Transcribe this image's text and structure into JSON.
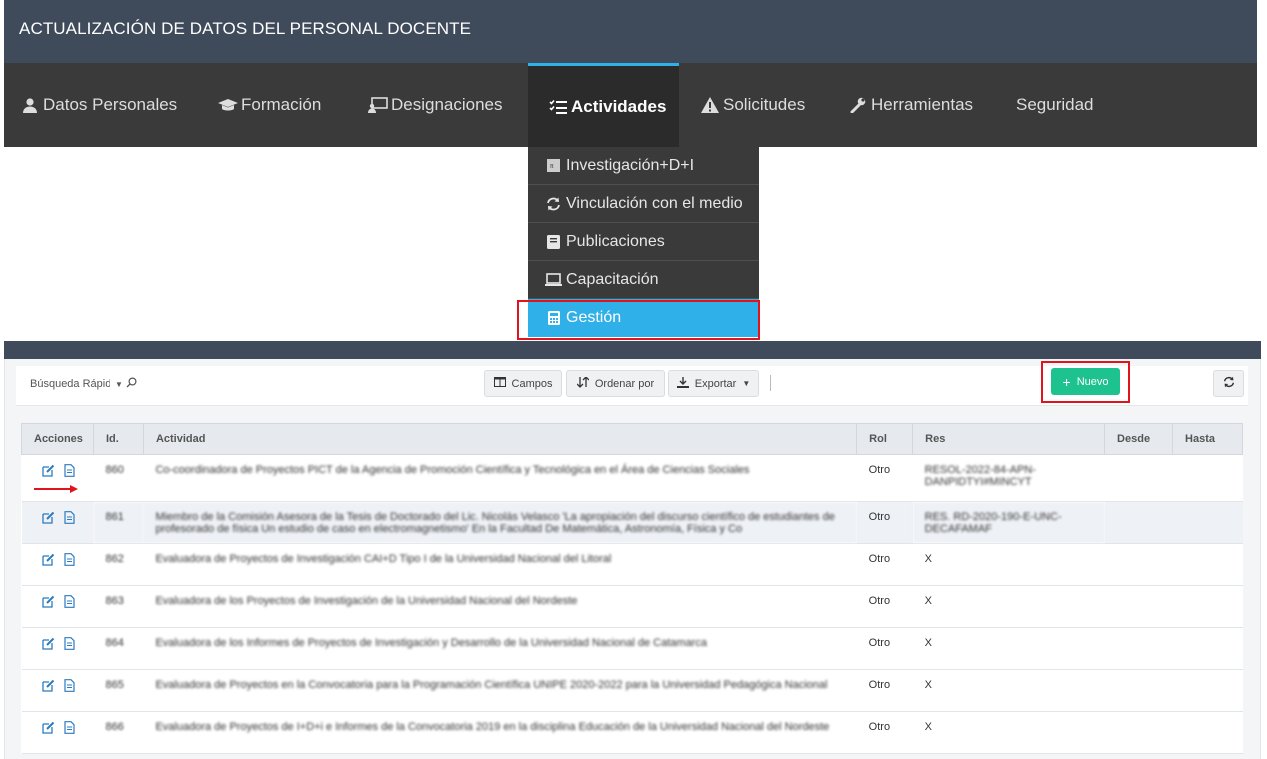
{
  "header": {
    "title": "ACTUALIZACIÓN DE DATOS DEL PERSONAL DOCENTE"
  },
  "nav": [
    {
      "label": "Datos Personales",
      "icon": "user-icon"
    },
    {
      "label": "Formación",
      "icon": "graduation-cap-icon"
    },
    {
      "label": "Designaciones",
      "icon": "presentation-icon"
    },
    {
      "label": "Actividades",
      "icon": "tasks-icon",
      "active": true
    },
    {
      "label": "Solicitudes",
      "icon": "warning-icon"
    },
    {
      "label": "Herramientas",
      "icon": "wrench-icon"
    },
    {
      "label": "Seguridad",
      "icon": ""
    }
  ],
  "dropdown": [
    {
      "label": "Investigación+D+I",
      "icon": "flask-icon"
    },
    {
      "label": "Vinculación con el medio",
      "icon": "refresh-icon"
    },
    {
      "label": "Publicaciones",
      "icon": "book-icon"
    },
    {
      "label": "Capacitación",
      "icon": "laptop-icon"
    },
    {
      "label": "Gestión",
      "icon": "calculator-icon",
      "selected": true
    }
  ],
  "toolbar": {
    "search_label": "Búsqueda Rápida",
    "campos": "Campos",
    "ordenar": "Ordenar por",
    "exportar": "Exportar",
    "nuevo": "Nuevo"
  },
  "table": {
    "columns": [
      "Acciones",
      "Id.",
      "Actividad",
      "Rol",
      "Res",
      "Desde",
      "Hasta"
    ],
    "rows": [
      {
        "id": "860",
        "actividad": "Co-coordinadora de Proyectos PICT de la Agencia de Promoción Científica y Tecnológica en el Área de Ciencias Sociales",
        "rol": "Otro",
        "res": "RESOL-2022-84-APN-DANPIDTYI#MINCYT",
        "desde": "",
        "hasta": ""
      },
      {
        "id": "861",
        "actividad": "Miembro de la Comisión Asesora de la Tesis de Doctorado del Lic. Nicolás Velasco 'La apropiación del discurso científico de estudiantes de profesorado de física Un estudio de caso en electromagnetismo' En la Facultad De Matemática, Astronomía, Física y Co",
        "rol": "Otro",
        "res": "RES. RD-2020-190-E-UNC-DECAFAMAF",
        "desde": "",
        "hasta": ""
      },
      {
        "id": "862",
        "actividad": "Evaluadora de Proyectos de Investigación CAI+D Tipo I de la Universidad Nacional del Litoral",
        "rol": "Otro",
        "res": "X",
        "desde": "",
        "hasta": ""
      },
      {
        "id": "863",
        "actividad": "Evaluadora de los Proyectos de Investigación de la Universidad Nacional del Nordeste",
        "rol": "Otro",
        "res": "X",
        "desde": "",
        "hasta": ""
      },
      {
        "id": "864",
        "actividad": "Evaluadora de los Informes de Proyectos de Investigación y Desarrollo de la Universidad Nacional de Catamarca",
        "rol": "Otro",
        "res": "X",
        "desde": "",
        "hasta": ""
      },
      {
        "id": "865",
        "actividad": "Evaluadora de Proyectos en la Convocatoria para la Programación Científica UNIPE 2020-2022 para la Universidad Pedagógica Nacional",
        "rol": "Otro",
        "res": "X",
        "desde": "",
        "hasta": ""
      },
      {
        "id": "866",
        "actividad": "Evaluadora de Proyectos de I+D+i e Informes de la Convocatoria 2019 en la disciplina Educación de la Universidad Nacional del Nordeste",
        "rol": "Otro",
        "res": "X",
        "desde": "",
        "hasta": ""
      }
    ]
  },
  "colors": {
    "accent": "#2fb0e8",
    "nuevo": "#1ec28e",
    "highlight": "#e0141c",
    "header": "#3f4a5a",
    "nav": "#3a3a3a"
  }
}
